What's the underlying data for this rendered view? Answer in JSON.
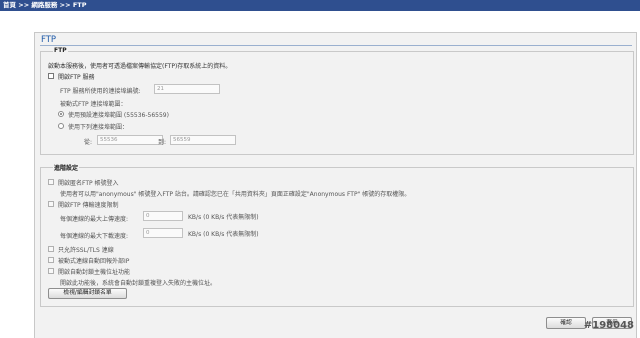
{
  "breadcrumb": "首頁 >> 網路服務 >> FTP",
  "page_title": "FTP",
  "ftp_section": {
    "legend": "FTP",
    "description": "啟動本服務後，使用者可透過檔案傳輸協定(FTP)存取系統上的資料。",
    "enable_ftp_label": "開啟FTP 服務",
    "port_label": "FTP 服務所使用的連接埠編號:",
    "port_value": "21",
    "passive_range_label": "被動式FTP 連接埠範圍：",
    "default_range_label": "使用預設連接埠範圍 (55536-56559)",
    "custom_range_label": "使用下列連接埠範圍：",
    "from_label": "從:",
    "from_value": "55536",
    "to_label": "到:",
    "to_value": "56559"
  },
  "advanced_section": {
    "legend": "進階設定",
    "anonymous_label": "開啟匿名FTP 帳號登入",
    "anonymous_note": "使用者可以用\"anonymous\" 帳號登入FTP 站台。請確認您已在「共用資料夾」頁面正確設定\"Anonymous FTP\" 帳號的存取權限。",
    "speed_limit_label": "開啟FTP 傳輸速度限制",
    "upload_label": "每個連線的最大上傳速度:",
    "upload_value": "0",
    "upload_unit": "KB/s (0 KB/s 代表無限制)",
    "download_label": "每個連線的最大下載速度:",
    "download_value": "0",
    "download_unit": "KB/s (0 KB/s 代表無限制)",
    "ssl_only_label": "只允許SSL/TLS 連線",
    "passive_external_ip_label": "被動式連線自動回報外部IP",
    "auto_block_label": "開啟自動封鎖主機位址功能",
    "auto_block_note": "開啟此功能後，系統會自動封鎖重複登入失敗的主機位址。",
    "block_list_button": "檢視/編輯封鎖名單"
  },
  "footer": {
    "ok_button": "確認",
    "apply_button": "套用"
  },
  "watermark": "#198048"
}
